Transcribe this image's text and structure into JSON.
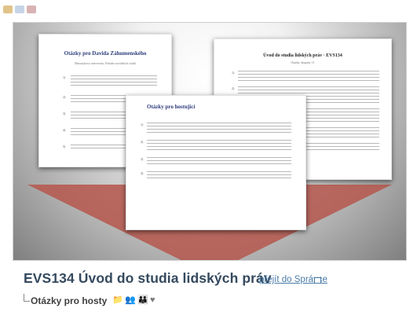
{
  "doc_left": {
    "title": "Otázky pro Davida Záhumenského",
    "subtitle": "Masarykova univerzita, Fakulta sociálních studií",
    "paragraph_lines": [
      4,
      3,
      3,
      3,
      2
    ]
  },
  "doc_right": {
    "title": "Úvod do studia lidských práv · EVS134",
    "subtitle": "Otázky skupiny 11",
    "paragraph_lines": [
      4,
      6,
      5,
      4,
      3
    ]
  },
  "doc_center": {
    "title": "Otázky pro hostující",
    "paragraph_lines": [
      4,
      4,
      3,
      3
    ]
  },
  "course": {
    "title": "EVS134 Úvod do studia lidských práv",
    "admin_link": "přejít do Správce"
  },
  "subitem": {
    "label": "Otázky pro hosty",
    "icons": [
      "folder-icon",
      "people-icon",
      "people-group-icon",
      "heart-icon"
    ]
  },
  "colors": {
    "title": "#34495e",
    "link": "#4a7ca8",
    "beam": "#b5574c"
  }
}
